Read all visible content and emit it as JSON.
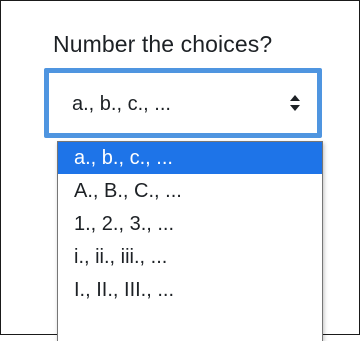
{
  "question": {
    "label": "Number the choices?"
  },
  "select": {
    "value": "a., b., c., ...",
    "arrows_icon": "up-down-chevron-icon"
  },
  "dropdown": {
    "options": [
      {
        "label": "a., b., c., ...",
        "selected": true
      },
      {
        "label": "A., B., C., ...",
        "selected": false
      },
      {
        "label": "1., 2., 3., ...",
        "selected": false
      },
      {
        "label": "i., ii., iii., ...",
        "selected": false
      },
      {
        "label": "I., II., III., ...",
        "selected": false
      }
    ]
  },
  "colors": {
    "focus_border": "#4f95e0",
    "selected_option_bg": "#1e74e8",
    "text": "#1d2125"
  }
}
